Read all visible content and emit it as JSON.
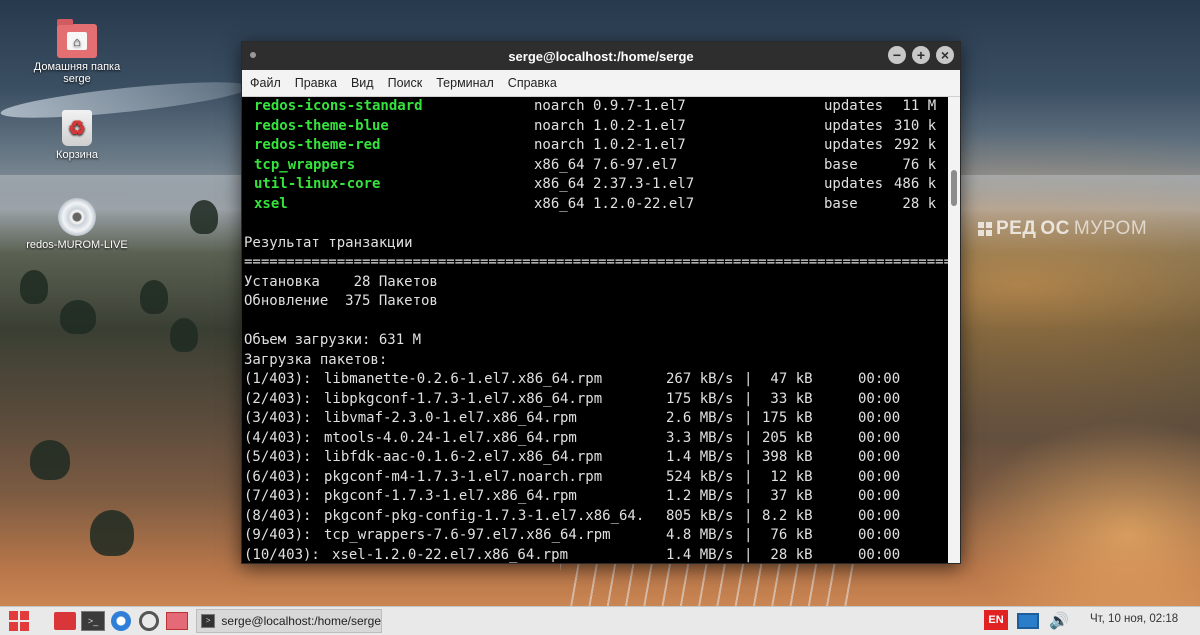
{
  "desktop": {
    "icons": [
      {
        "label": "Домашняя папка\nserge",
        "label_line1": "Домашняя папка",
        "label_line2": "serge",
        "icon": "home-folder-icon"
      },
      {
        "label": "Корзина",
        "icon": "trash-icon"
      },
      {
        "label": "redos-MUROM-LIVE",
        "icon": "disc-icon"
      }
    ],
    "watermark": {
      "part1": "РЕД",
      "part2": "ОС",
      "part3": "МУРОМ"
    }
  },
  "window": {
    "title": "serge@localhost:/home/serge",
    "menu": [
      "Файл",
      "Правка",
      "Вид",
      "Поиск",
      "Терминал",
      "Справка"
    ]
  },
  "terminal": {
    "packages": [
      {
        "name": "redos-icons-standard",
        "arch_version": "noarch 0.9.7-1.el7",
        "repo": "updates",
        "size": " 11 M"
      },
      {
        "name": "redos-theme-blue",
        "arch_version": "noarch 1.0.2-1.el7",
        "repo": "updates",
        "size": "310 k"
      },
      {
        "name": "redos-theme-red",
        "arch_version": "noarch 1.0.2-1.el7",
        "repo": "updates",
        "size": "292 k"
      },
      {
        "name": "tcp_wrappers",
        "arch_version": "x86_64 7.6-97.el7",
        "repo": "base",
        "size": " 76 k"
      },
      {
        "name": "util-linux-core",
        "arch_version": "x86_64 2.37.3-1.el7",
        "repo": "updates",
        "size": "486 k"
      },
      {
        "name": "xsel",
        "arch_version": "x86_64 1.2.0-22.el7",
        "repo": "base",
        "size": " 28 k"
      }
    ],
    "result_heading": "Результат транзакции",
    "separator": "================================================================================================",
    "install_line": "Установка    28 Пакетов",
    "update_line": "Обновление  375 Пакетов",
    "download_size": "Объем загрузки: 631 M",
    "downloading": "Загрузка пакетов:",
    "downloads": [
      {
        "index": "(1/403):",
        "file": "libmanette-0.2.6-1.el7.x86_64.rpm",
        "speed": "267 kB/s",
        "size": " 47 kB",
        "time": "00:00"
      },
      {
        "index": "(2/403):",
        "file": "libpkgconf-1.7.3-1.el7.x86_64.rpm",
        "speed": "175 kB/s",
        "size": " 33 kB",
        "time": "00:00"
      },
      {
        "index": "(3/403):",
        "file": "libvmaf-2.3.0-1.el7.x86_64.rpm",
        "speed": "2.6 MB/s",
        "size": "175 kB",
        "time": "00:00"
      },
      {
        "index": "(4/403):",
        "file": "mtools-4.0.24-1.el7.x86_64.rpm",
        "speed": "3.3 MB/s",
        "size": "205 kB",
        "time": "00:00"
      },
      {
        "index": "(5/403):",
        "file": "libfdk-aac-0.1.6-2.el7.x86_64.rpm",
        "speed": "1.4 MB/s",
        "size": "398 kB",
        "time": "00:00"
      },
      {
        "index": "(6/403):",
        "file": "pkgconf-m4-1.7.3-1.el7.noarch.rpm",
        "speed": "524 kB/s",
        "size": " 12 kB",
        "time": "00:00"
      },
      {
        "index": "(7/403):",
        "file": "pkgconf-1.7.3-1.el7.x86_64.rpm",
        "speed": "1.2 MB/s",
        "size": " 37 kB",
        "time": "00:00"
      },
      {
        "index": "(8/403):",
        "file": "pkgconf-pkg-config-1.7.3-1.el7.x86_64.",
        "speed": "805 kB/s",
        "size": "8.2 kB",
        "time": "00:00"
      },
      {
        "index": "(9/403):",
        "file": "tcp_wrappers-7.6-97.el7.x86_64.rpm",
        "speed": "4.8 MB/s",
        "size": " 76 kB",
        "time": "00:00"
      },
      {
        "index": "(10/403):",
        "file": "xsel-1.2.0-22.el7.x86_64.rpm",
        "speed": "1.4 MB/s",
        "size": " 28 kB",
        "time": "00:00"
      }
    ]
  },
  "taskbar": {
    "task_title": "serge@localhost:/home/serge",
    "language": "EN",
    "clock": "Чт, 10 ноя, 02:18"
  }
}
